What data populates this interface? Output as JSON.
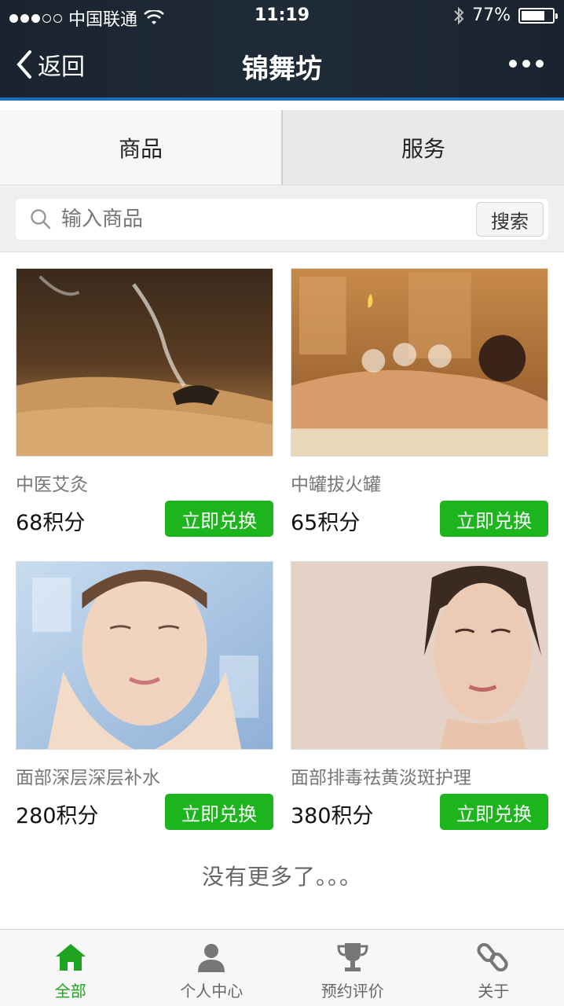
{
  "status_bar": {
    "carrier": "中国联通",
    "time": "11:19",
    "battery": "77%",
    "battery_level": 0.77
  },
  "nav": {
    "back_label": "返回",
    "title": "锦舞坊"
  },
  "tabs": [
    {
      "label": "商品",
      "active": true
    },
    {
      "label": "服务",
      "active": false
    }
  ],
  "search": {
    "placeholder": "输入商品",
    "button_label": "搜索"
  },
  "products": [
    {
      "name": "中医艾灸",
      "price": "68积分",
      "button": "立即兑换",
      "image": "moxibustion-photo"
    },
    {
      "name": "中罐拔火罐",
      "price": "65积分",
      "button": "立即兑换",
      "image": "cupping-photo"
    },
    {
      "name": "面部深层深层补水",
      "price": "280积分",
      "button": "立即兑换",
      "image": "face-hydration-photo"
    },
    {
      "name": "面部排毒祛黄淡斑护理",
      "price": "380积分",
      "button": "立即兑换",
      "image": "face-care-photo"
    }
  ],
  "footer_text": "没有更多了。。。",
  "tabbar": [
    {
      "label": "全部",
      "icon": "home-icon",
      "active": true
    },
    {
      "label": "个人中心",
      "icon": "user-icon",
      "active": false
    },
    {
      "label": "预约评价",
      "icon": "trophy-icon",
      "active": false
    },
    {
      "label": "关于",
      "icon": "link-icon",
      "active": false
    }
  ],
  "colors": {
    "accent_green": "#1db51d",
    "nav_bg": "#1f2b36",
    "nav_stripe": "#1b6fb8"
  }
}
